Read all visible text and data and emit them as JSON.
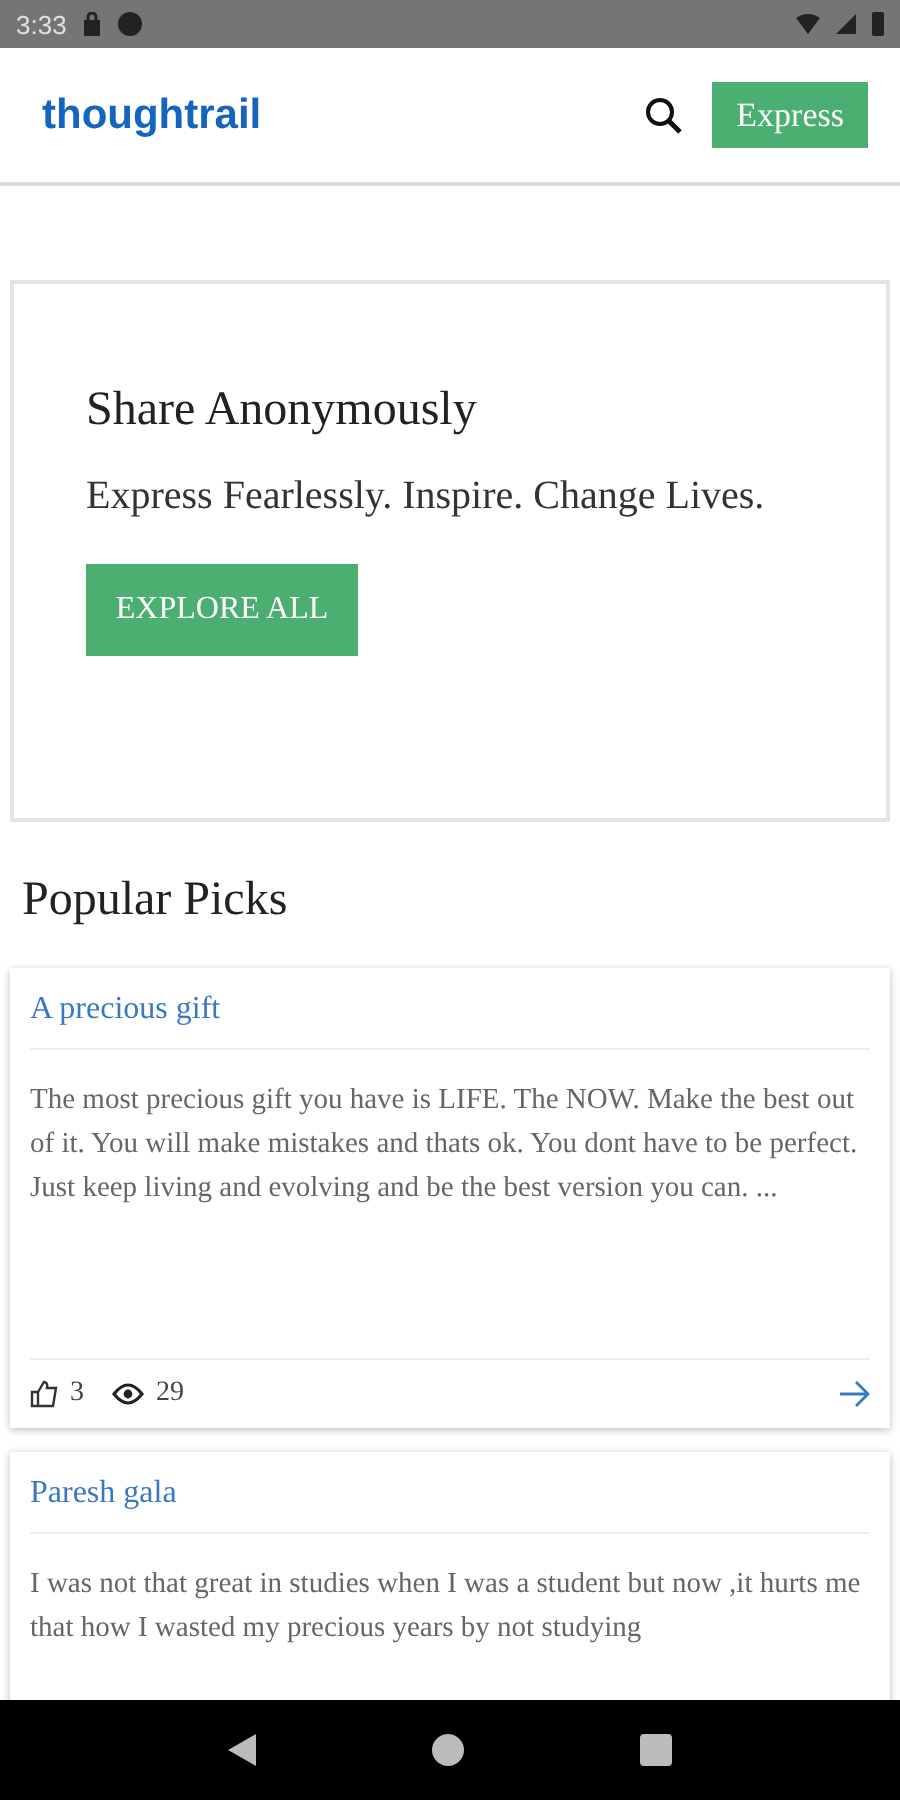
{
  "status_bar": {
    "time": "3:33"
  },
  "header": {
    "logo": "thoughtrail",
    "action": "Express"
  },
  "hero": {
    "title": "Share Anonymously",
    "subtitle": "Express Fearlessly. Inspire. Change Lives.",
    "button": "EXPLORE ALL"
  },
  "section_title": "Popular Picks",
  "posts": [
    {
      "title": "A precious gift",
      "excerpt": "The most precious gift you have is LIFE. The NOW. Make the best out of it. You will make mistakes and thats ok. You dont have to be perfect. Just keep living and evolving and be the best version you can. ...",
      "likes": "3",
      "views": "29"
    },
    {
      "title": "Paresh gala",
      "excerpt": "I was not that great in studies when I was a student but now ,it hurts me that how I wasted  my precious years by not studying"
    }
  ]
}
